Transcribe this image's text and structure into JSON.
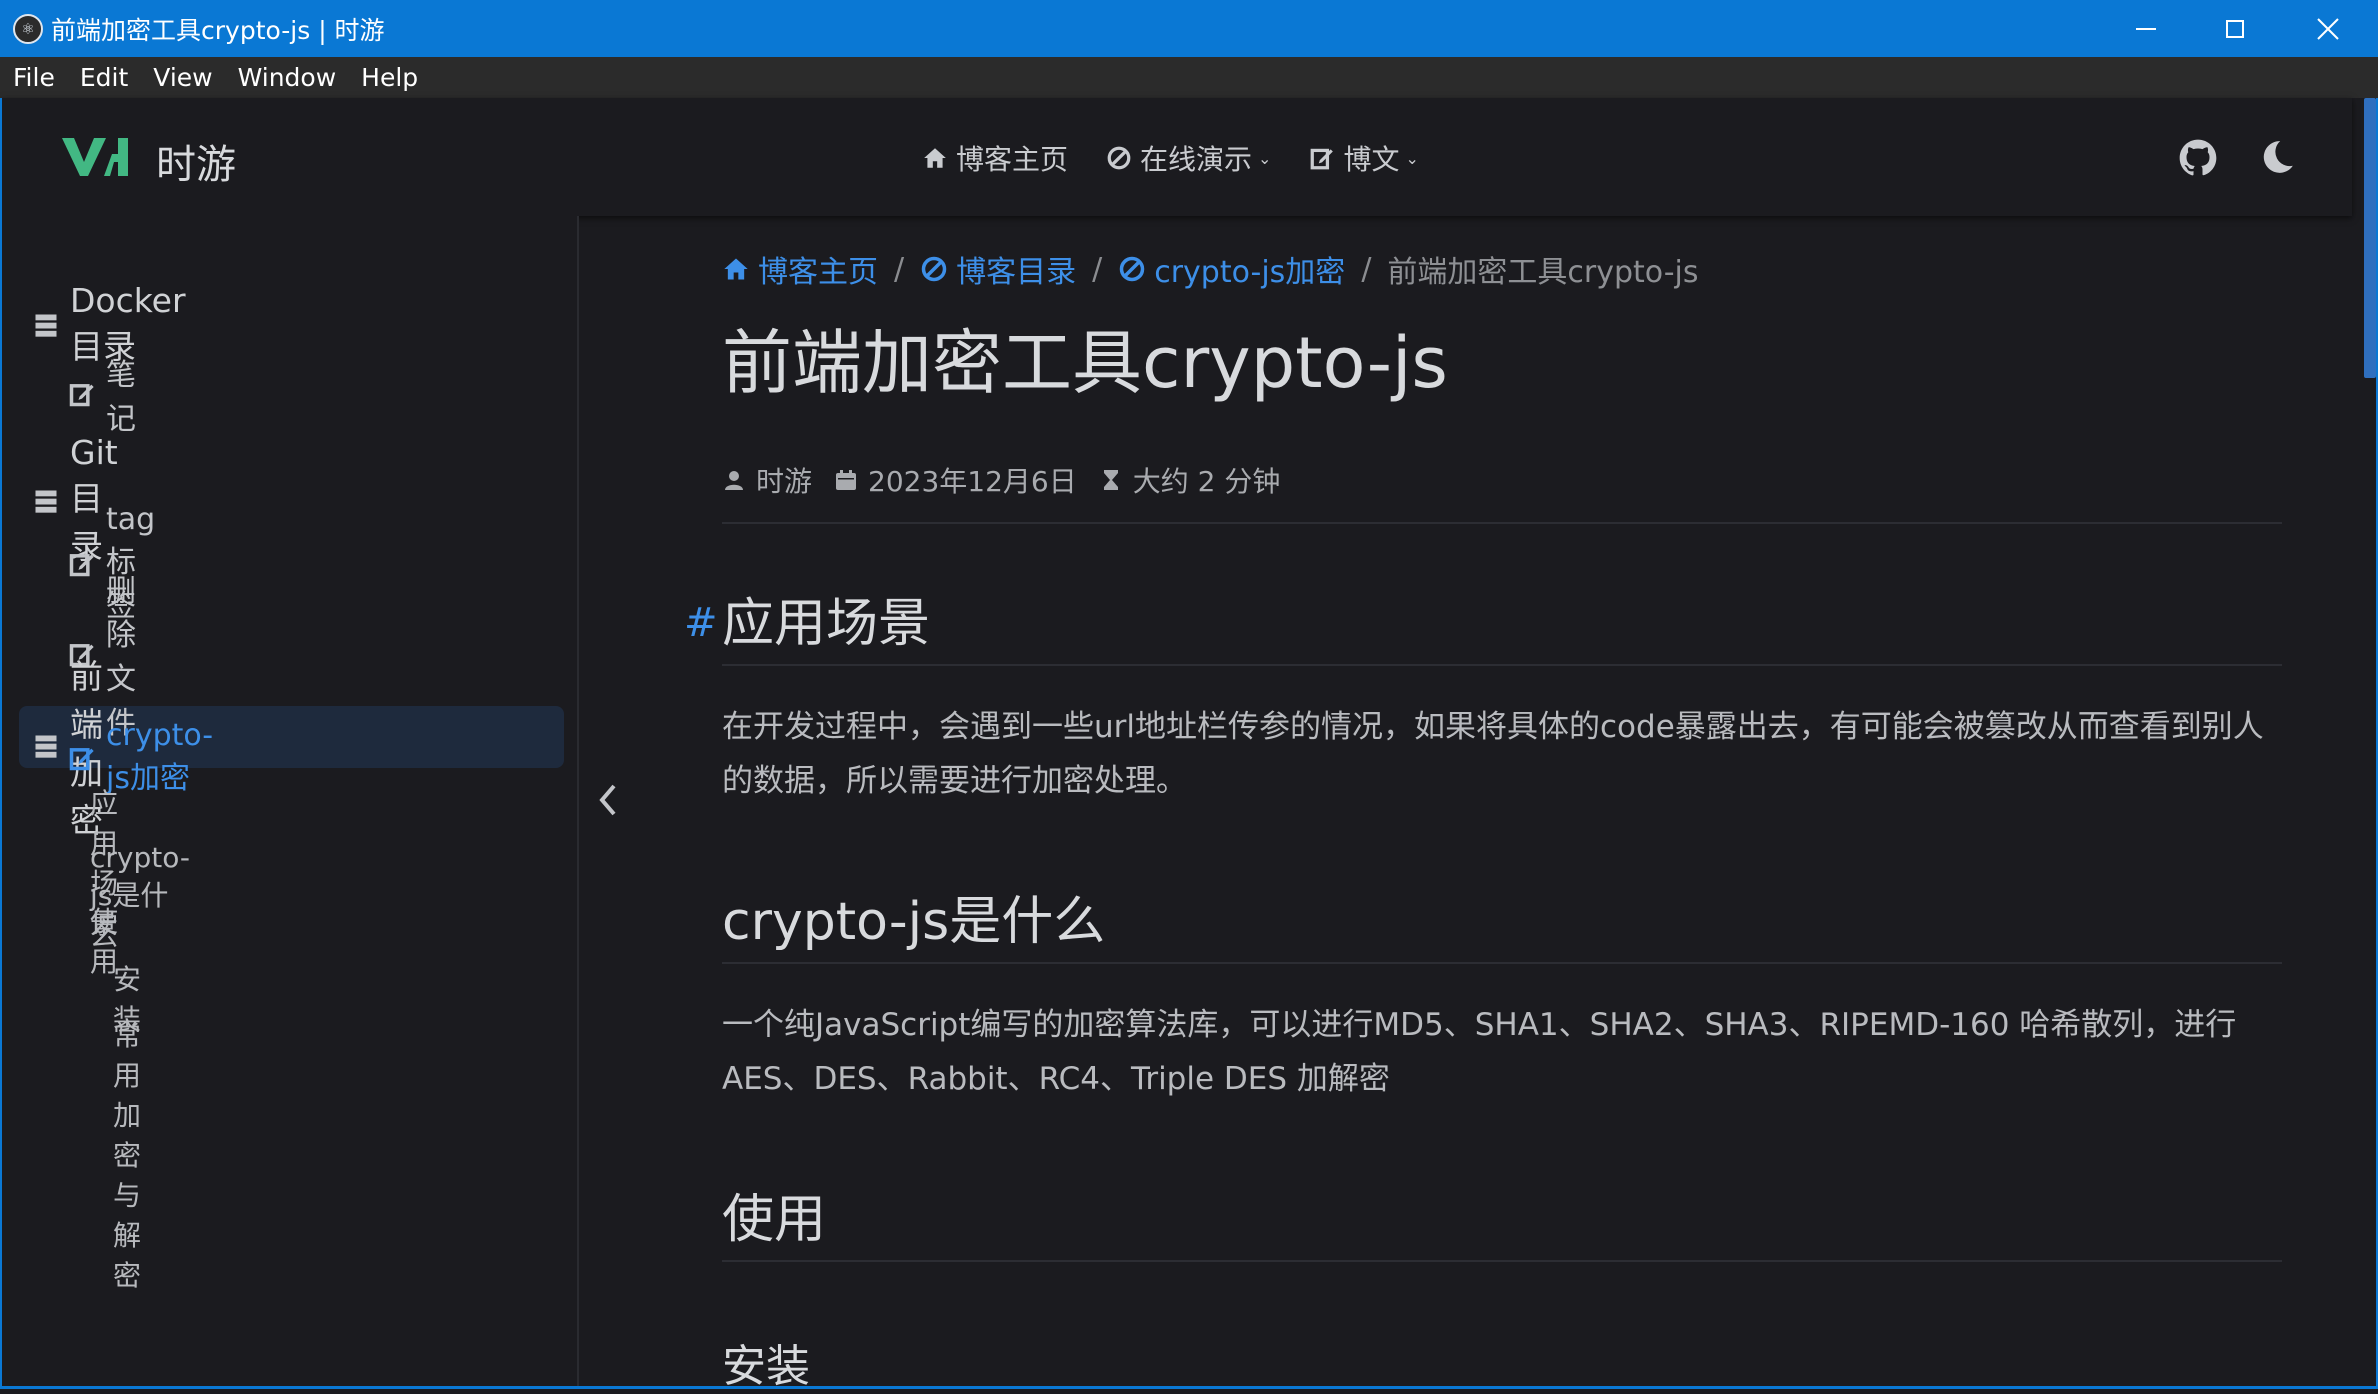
{
  "window": {
    "title": "前端加密工具crypto-js | 时游",
    "app_icon": "electron-icon",
    "controls": [
      "minimize-icon",
      "maximize-icon",
      "close-icon"
    ]
  },
  "menubar": {
    "items": [
      "File",
      "Edit",
      "View",
      "Window",
      "Help"
    ]
  },
  "navbar": {
    "site_name": "时游",
    "logo_color": "#42b883",
    "links": [
      {
        "label": "博客主页",
        "icon": "home-icon"
      },
      {
        "label": "在线演示",
        "icon": "link-icon",
        "dropdown": true
      },
      {
        "label": "博文",
        "icon": "edit-icon",
        "dropdown": true
      }
    ],
    "right_icons": [
      "github-icon",
      "moon-icon"
    ]
  },
  "sidebar": {
    "groups": [
      {
        "label": "Docker目录",
        "items": [
          "笔记"
        ]
      },
      {
        "label": "Git目录",
        "items": [
          "tag标签",
          "删除文件"
        ]
      },
      {
        "label": "前端加密",
        "items": [
          "crypto-js加密"
        ]
      }
    ],
    "active_item": "crypto-js加密",
    "toc": {
      "h2": [
        "应用场景",
        "crypto-js是什么",
        "使用"
      ],
      "h3": [
        "安装",
        "常用加密与解密"
      ]
    },
    "toggle_icon": "chevron-left-icon"
  },
  "breadcrumb": {
    "items": [
      "博客主页",
      "博客目录",
      "crypto-js加密"
    ],
    "current": "前端加密工具crypto-js",
    "separator": "/"
  },
  "article": {
    "title": "前端加密工具crypto-js",
    "meta": {
      "author": "时游",
      "date": "2023年12月6日",
      "reading_time": "大约 2 分钟"
    },
    "anchor": "#",
    "sections": [
      {
        "heading": "应用场景",
        "text": "在开发过程中，会遇到一些url地址栏传参的情况，如果将具体的code暴露出去，有可能会被篡改从而查看到别人的数据，所以需要进行加密处理。"
      },
      {
        "heading": "crypto-js是什么",
        "text": "一个纯JavaScript编写的加密算法库，可以进行MD5、SHA1、SHA2、SHA3、RIPEMD-160 哈希散列，进行AES、DES、Rabbit、RC4、Triple DES 加解密"
      },
      {
        "heading": "使用",
        "subheading": "安装"
      }
    ]
  },
  "colors": {
    "accent": "#3d8fe8",
    "titlebar": "#0a78d4",
    "background": "#1b1b1f",
    "active_bg": "#1e2a3d"
  }
}
